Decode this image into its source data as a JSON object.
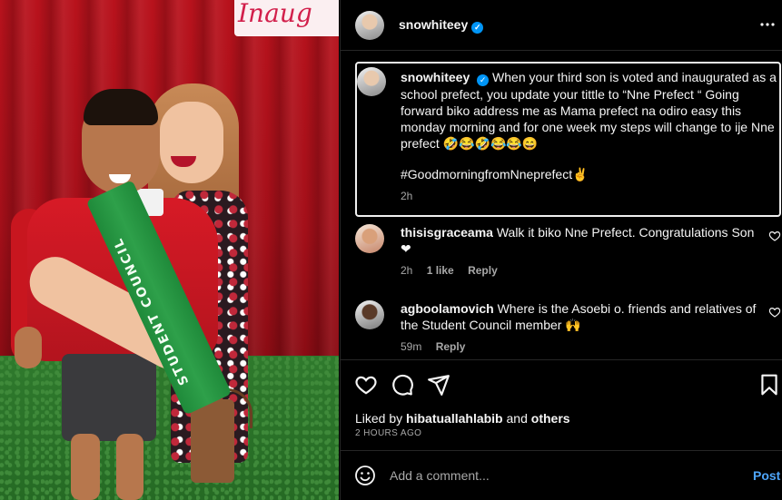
{
  "photo": {
    "banner_text": "Inaug",
    "sash_text": "STUDENT COUNCIL"
  },
  "post": {
    "username": "snowhiteey",
    "verified": true
  },
  "caption": {
    "username": "snowhiteey",
    "text": "When your third son is voted and inaugurated as a school prefect, you update your tittle to “Nne Prefect “ Going forward biko address me as Mama prefect na odiro easy this monday morning and for one week my steps will change to ije Nne prefect 🤣😂🤣😂😂😄",
    "hashtag": "#GoodmorningfromNneprefect✌",
    "time": "2h"
  },
  "comments": [
    {
      "username": "thisisgraceama",
      "text": "Walk it biko Nne Prefect. Congratulations Son ❤",
      "time": "2h",
      "likes": "1 like",
      "reply": "Reply"
    },
    {
      "username": "agboolamovich",
      "text": "Where is the Asoebi o. friends and relatives of the Student Council member 🙌",
      "time": "59m",
      "reply": "Reply"
    }
  ],
  "likes": {
    "prefix": "Liked by",
    "user": "hibatuallahlabib",
    "conjunction": "and",
    "others": "others"
  },
  "post_date": "2 HOURS AGO",
  "comment_box": {
    "placeholder": "Add a comment...",
    "post_label": "Post"
  },
  "colors": {
    "background": "#000000",
    "accent": "#0095f6",
    "post_link": "#4ea5f9",
    "heart": "#ff3040",
    "muted_text": "#a8a8a8"
  }
}
